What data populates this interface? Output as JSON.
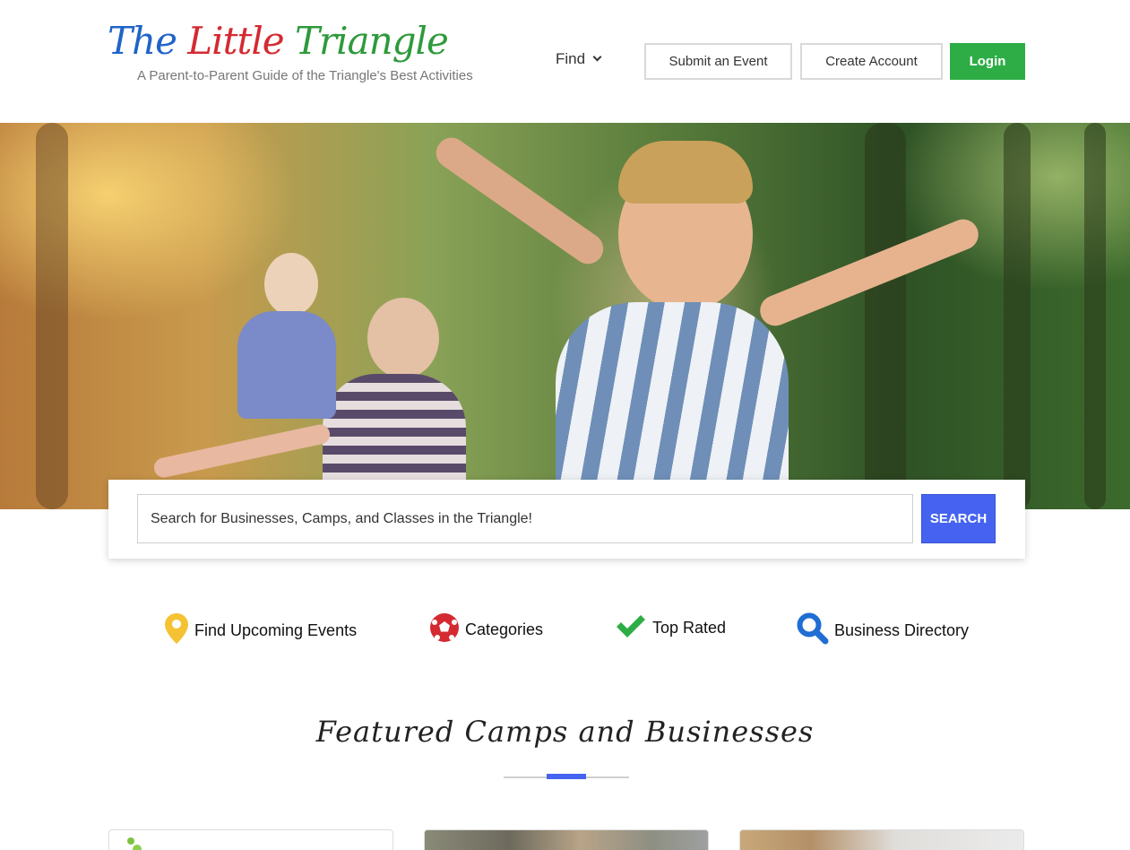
{
  "header": {
    "logo": {
      "word1": "The",
      "word2": "Little",
      "word3": "Triangle",
      "tagline": "A Parent-to-Parent Guide of the Triangle's Best Activities"
    },
    "nav": {
      "find_label": "Find",
      "submit_event_label": "Submit an Event",
      "create_account_label": "Create Account",
      "login_label": "Login"
    }
  },
  "search": {
    "placeholder": "Search for Businesses, Camps, and Classes in the Triangle!",
    "button_label": "SEARCH"
  },
  "quick_links": [
    {
      "label": "Find Upcoming Events",
      "icon": "map-pin-icon"
    },
    {
      "label": "Categories",
      "icon": "soccer-ball-icon"
    },
    {
      "label": "Top Rated",
      "icon": "checkmark-icon"
    },
    {
      "label": "Business Directory",
      "icon": "magnifier-icon"
    }
  ],
  "featured": {
    "title": "Featured Camps and Businesses"
  },
  "colors": {
    "accent_blue": "#4563f0",
    "login_green": "#2ead46",
    "logo_blue": "#1f64c8",
    "logo_red": "#d42a32",
    "logo_green": "#2e9a3c"
  }
}
